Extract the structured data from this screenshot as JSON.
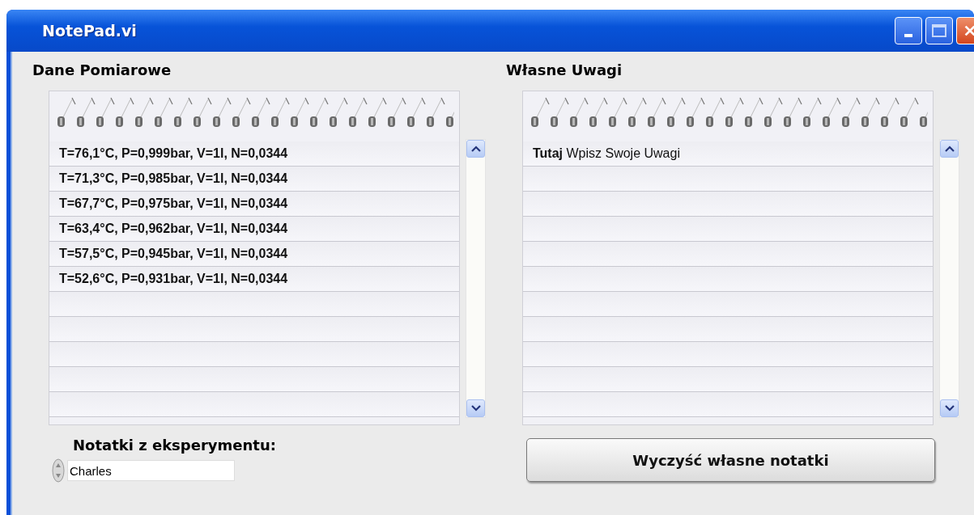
{
  "window": {
    "title": "NotePad.vi"
  },
  "panels": [
    {
      "label": "Dane Pomiarowe",
      "lines": [
        "T=76,1°C, P=0,999bar, V=1l, N=0,0344",
        "T=71,3°C, P=0,985bar, V=1l, N=0,0344",
        "T=67,7°C, P=0,975bar, V=1l, N=0,0344",
        "T=63,4°C, P=0,962bar, V=1l, N=0,0344",
        "T=57,5°C, P=0,945bar, V=1l, N=0,0344",
        "T=52,6°C, P=0,931bar, V=1l, N=0,0344"
      ]
    },
    {
      "label": "Własne Uwagi",
      "lines": [
        "**Tutaj** Wpisz Swoje Uwagi"
      ]
    }
  ],
  "notes": {
    "label": "Notatki z eksperymentu:",
    "value": "Charles"
  },
  "clear_button": {
    "label": "Wyczyść własne notatki"
  }
}
